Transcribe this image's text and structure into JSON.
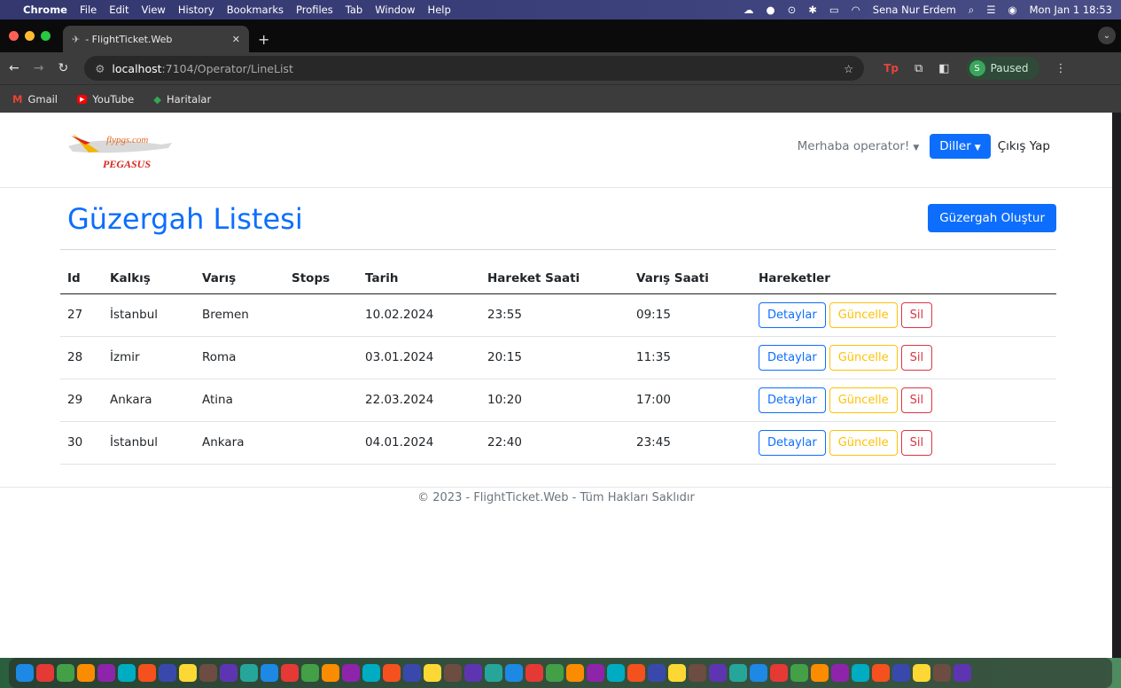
{
  "menubar": {
    "app": "Chrome",
    "items": [
      "File",
      "Edit",
      "View",
      "History",
      "Bookmarks",
      "Profiles",
      "Tab",
      "Window",
      "Help"
    ],
    "user": "Sena Nur Erdem",
    "clock": "Mon Jan 1  18:53"
  },
  "browser": {
    "tab_title": "- FlightTicket.Web",
    "url_host": "localhost",
    "url_path": ":7104/Operator/LineList",
    "profile_status": "Paused",
    "profile_initial": "S",
    "bookmarks": [
      "Gmail",
      "YouTube",
      "Haritalar"
    ]
  },
  "site": {
    "logo_text": "flypgs.com",
    "logo_brand": "PEGASUS",
    "greeting": "Merhaba operator!",
    "languages_label": "Diller",
    "logout_label": "Çıkış Yap"
  },
  "main": {
    "title": "Güzergah Listesi",
    "create_button": "Güzergah Oluştur",
    "columns": [
      "Id",
      "Kalkış",
      "Varış",
      "Stops",
      "Tarih",
      "Hareket Saati",
      "Varış Saati",
      "Hareketler"
    ],
    "rows": [
      {
        "id": "27",
        "from": "İstanbul",
        "to": "Bremen",
        "stops": "",
        "date": "10.02.2024",
        "dep": "23:55",
        "arr": "09:15"
      },
      {
        "id": "28",
        "from": "İzmir",
        "to": "Roma",
        "stops": "",
        "date": "03.01.2024",
        "dep": "20:15",
        "arr": "11:35"
      },
      {
        "id": "29",
        "from": "Ankara",
        "to": "Atina",
        "stops": "",
        "date": "22.03.2024",
        "dep": "10:20",
        "arr": "17:00"
      },
      {
        "id": "30",
        "from": "İstanbul",
        "to": "Ankara",
        "stops": "",
        "date": "04.01.2024",
        "dep": "22:40",
        "arr": "23:45"
      }
    ],
    "actions": {
      "details": "Detaylar",
      "update": "Güncelle",
      "delete": "Sil"
    }
  },
  "footer": {
    "text": "© 2023 - FlightTicket.Web - Tüm Hakları Saklıdır"
  },
  "colors": {
    "primary": "#0d6efd",
    "warning": "#ffc107",
    "danger": "#dc3545"
  },
  "dock_icons": [
    "finder",
    "launchpad",
    "spotify",
    "whatsapp",
    "safari",
    "mail",
    "messages",
    "facetime",
    "photos",
    "calendar",
    "notes",
    "chrome",
    "finder2",
    "podcasts",
    "numbers",
    "keynote",
    "pages",
    "music",
    "slack",
    "settings",
    "appstore",
    "teams",
    "edge",
    "vscode-alt",
    "xcode",
    "vscode",
    "figma",
    "postman",
    "git",
    "intellij",
    "sourcetree",
    "outlook",
    "acrobat",
    "zoom",
    "github",
    "terminal",
    "sublime",
    "db",
    "dbeaver",
    "rider",
    "dotnet",
    "powerpoint",
    "word",
    "preview",
    "notes2",
    "downloads",
    "trash"
  ]
}
